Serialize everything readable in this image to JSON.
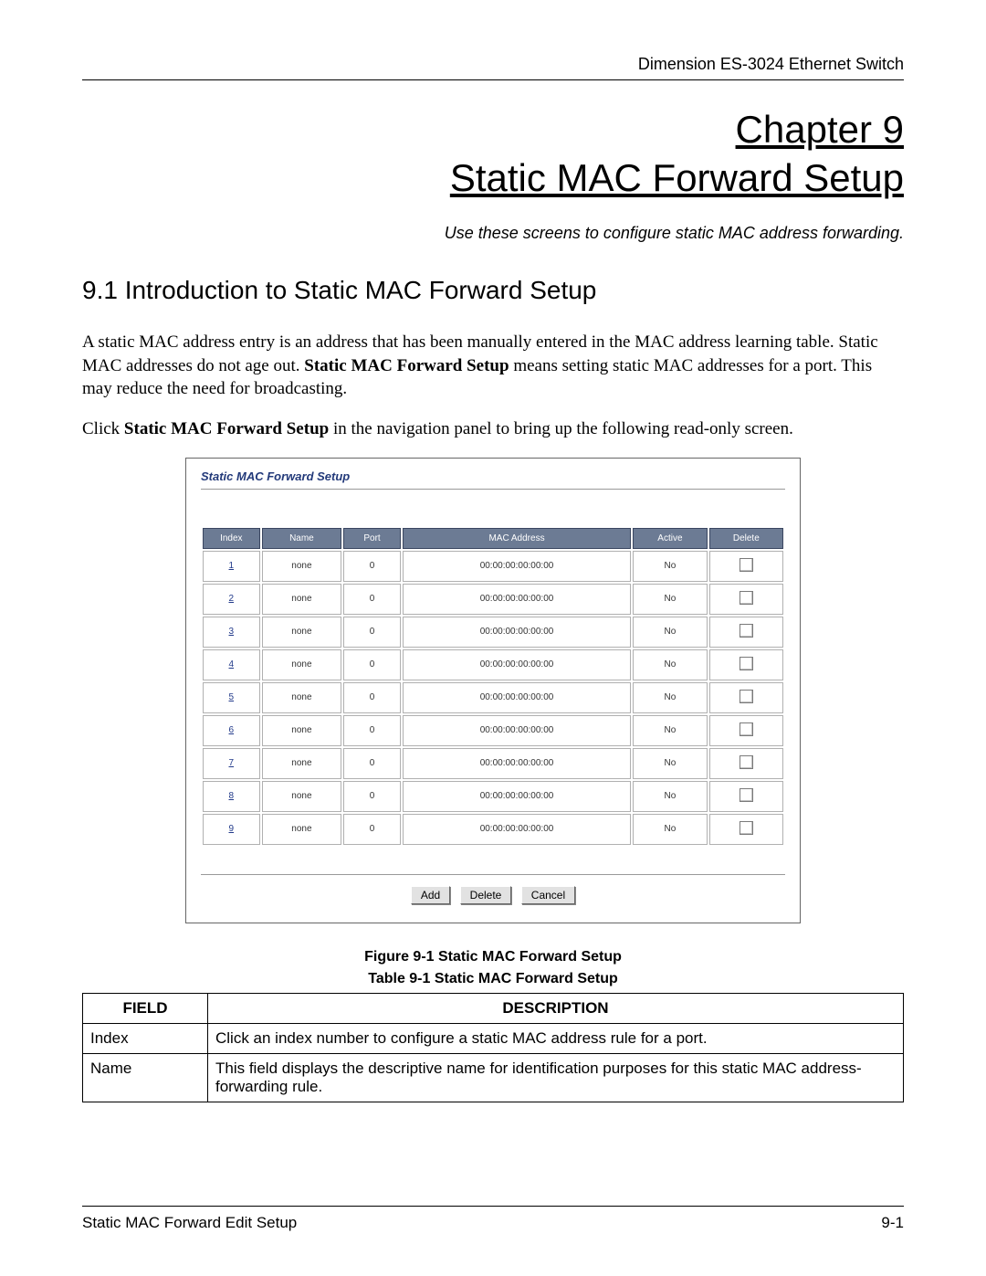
{
  "header_right": "Dimension ES-3024 Ethernet Switch",
  "chapter_line1": "Chapter 9",
  "chapter_line2": "Static MAC Forward Setup",
  "subtitle": "Use these screens to configure static MAC address forwarding.",
  "section_heading": "9.1  Introduction to Static MAC Forward Setup",
  "para1_a": "A static MAC address entry is an address that has been manually entered in the MAC address learning table. Static MAC addresses do not age out. ",
  "para1_bold": "Static MAC Forward Setup",
  "para1_b": " means setting static MAC addresses for a port. This may reduce the need for broadcasting.",
  "para2_a": "Click ",
  "para2_bold": "Static MAC Forward Setup",
  "para2_b": " in the navigation panel to bring up the following read-only screen.",
  "shot": {
    "title": "Static MAC Forward Setup",
    "columns": [
      "Index",
      "Name",
      "Port",
      "MAC Address",
      "Active",
      "Delete"
    ],
    "rows": [
      {
        "index": "1",
        "name": "none",
        "port": "0",
        "mac": "00:00:00:00:00:00",
        "active": "No"
      },
      {
        "index": "2",
        "name": "none",
        "port": "0",
        "mac": "00:00:00:00:00:00",
        "active": "No"
      },
      {
        "index": "3",
        "name": "none",
        "port": "0",
        "mac": "00:00:00:00:00:00",
        "active": "No"
      },
      {
        "index": "4",
        "name": "none",
        "port": "0",
        "mac": "00:00:00:00:00:00",
        "active": "No"
      },
      {
        "index": "5",
        "name": "none",
        "port": "0",
        "mac": "00:00:00:00:00:00",
        "active": "No"
      },
      {
        "index": "6",
        "name": "none",
        "port": "0",
        "mac": "00:00:00:00:00:00",
        "active": "No"
      },
      {
        "index": "7",
        "name": "none",
        "port": "0",
        "mac": "00:00:00:00:00:00",
        "active": "No"
      },
      {
        "index": "8",
        "name": "none",
        "port": "0",
        "mac": "00:00:00:00:00:00",
        "active": "No"
      },
      {
        "index": "9",
        "name": "none",
        "port": "0",
        "mac": "00:00:00:00:00:00",
        "active": "No"
      }
    ],
    "buttons": {
      "add": "Add",
      "delete": "Delete",
      "cancel": "Cancel"
    }
  },
  "figure_caption": "Figure 9-1 Static MAC Forward Setup",
  "table_caption": "Table 9-1 Static MAC Forward Setup",
  "desc_headers": {
    "field": "FIELD",
    "description": "DESCRIPTION"
  },
  "desc_rows": [
    {
      "field": "Index",
      "desc": "Click an index number to configure a static MAC address rule for a port."
    },
    {
      "field": "Name",
      "desc": "This field displays the descriptive name for identification purposes for this static MAC address-forwarding rule."
    }
  ],
  "footer_left": "Static MAC Forward Edit Setup",
  "footer_right": "9-1"
}
